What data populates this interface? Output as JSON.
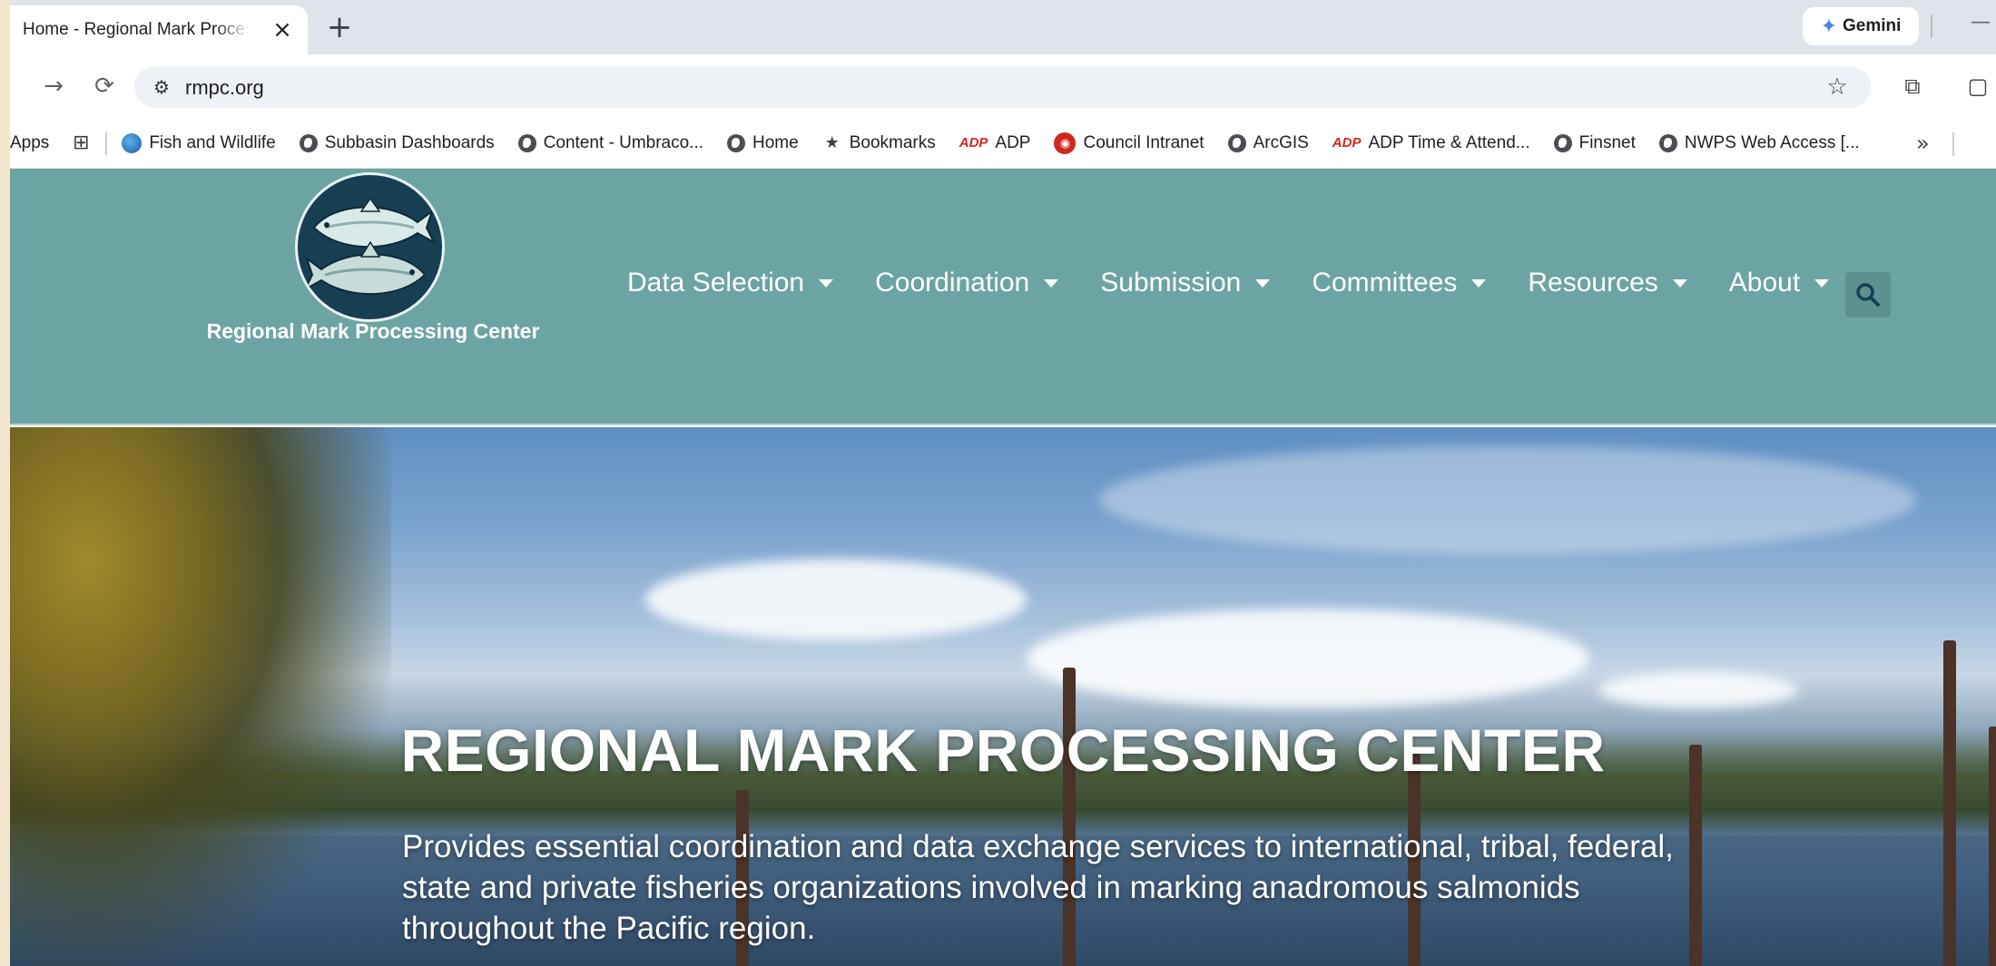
{
  "browser": {
    "tab": {
      "title": "Home - Regional Mark Processing Center"
    },
    "gemini_label": "Gemini",
    "url": "rmpc.org"
  },
  "bookmarks": [
    {
      "label": "Apps",
      "icon": "apps-icon"
    },
    {
      "label": "",
      "icon": "grid-icon"
    },
    {
      "label": "Fish and Wildlife",
      "icon": "fish-wildlife-icon"
    },
    {
      "label": "Subbasin Dashboards",
      "icon": "globe-icon"
    },
    {
      "label": "Content - Umbraco...",
      "icon": "globe-icon"
    },
    {
      "label": "Home",
      "icon": "globe-icon"
    },
    {
      "label": "Bookmarks",
      "icon": "star-icon"
    },
    {
      "label": "ADP",
      "icon": "adp-icon"
    },
    {
      "label": "Council Intranet",
      "icon": "council-icon"
    },
    {
      "label": "ArcGIS",
      "icon": "globe-icon"
    },
    {
      "label": "ADP Time & Attend...",
      "icon": "adp-icon"
    },
    {
      "label": "Finsnet",
      "icon": "globe-icon"
    },
    {
      "label": "NWPS Web Access [...",
      "icon": "globe-icon"
    }
  ],
  "site": {
    "name": "Regional Mark Processing Center",
    "nav": [
      {
        "label": "Data Selection"
      },
      {
        "label": "Coordination"
      },
      {
        "label": "Submission"
      },
      {
        "label": "Committees"
      },
      {
        "label": "Resources"
      },
      {
        "label": "About"
      }
    ],
    "hero": {
      "title": "REGIONAL MARK PROCESSING CENTER",
      "text": "Provides essential coordination and data exchange services to international, tribal, federal, state and private fisheries organizations involved in marking anadromous salmonids throughout the Pacific region."
    }
  },
  "colors": {
    "header_bg": "#6ca4a3",
    "logo_bg": "#173f52"
  }
}
